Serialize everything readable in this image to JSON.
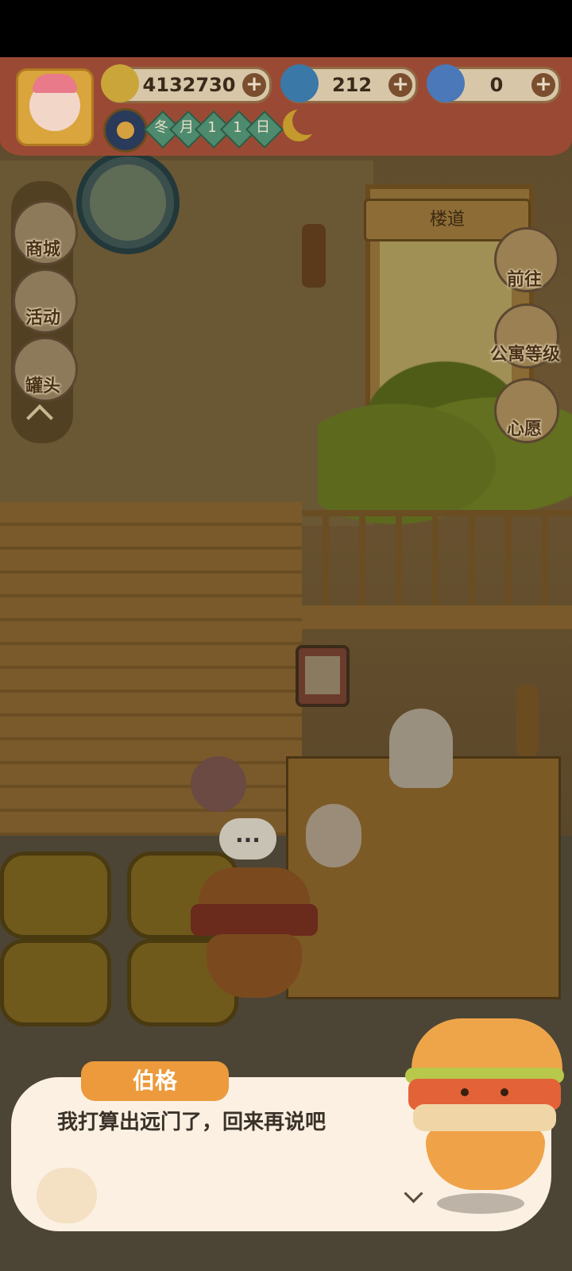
{
  "hud": {
    "currencies": [
      {
        "icon": "banana-icon",
        "value": "4132730"
      },
      {
        "icon": "flame-icon",
        "value": "212"
      },
      {
        "icon": "blue-banana-icon",
        "value": "0"
      }
    ],
    "plus_symbol": "+",
    "date": [
      "冬",
      "月",
      "1",
      "1",
      "日"
    ]
  },
  "scene": {
    "door_sign": "楼道",
    "bubble_text": "..."
  },
  "left_menu": {
    "items": [
      {
        "label": "商城",
        "icon": "shop-icon"
      },
      {
        "label": "活动",
        "icon": "gift-icon"
      },
      {
        "label": "罐头",
        "icon": "can-icon"
      }
    ]
  },
  "right_menu": {
    "items": [
      {
        "label": "前往",
        "icon": "map-pin-icon"
      },
      {
        "label": "公寓等级",
        "icon": "cat-badge-icon"
      },
      {
        "label": "心愿",
        "icon": "heart-book-icon"
      }
    ]
  },
  "dialog": {
    "speaker": "伯格",
    "text": "我打算出远门了，回来再说吧"
  },
  "colors": {
    "hud_red": "#9a4a34",
    "name_tag": "#ec9a3c",
    "dialog_bg": "#fbf0e2"
  }
}
